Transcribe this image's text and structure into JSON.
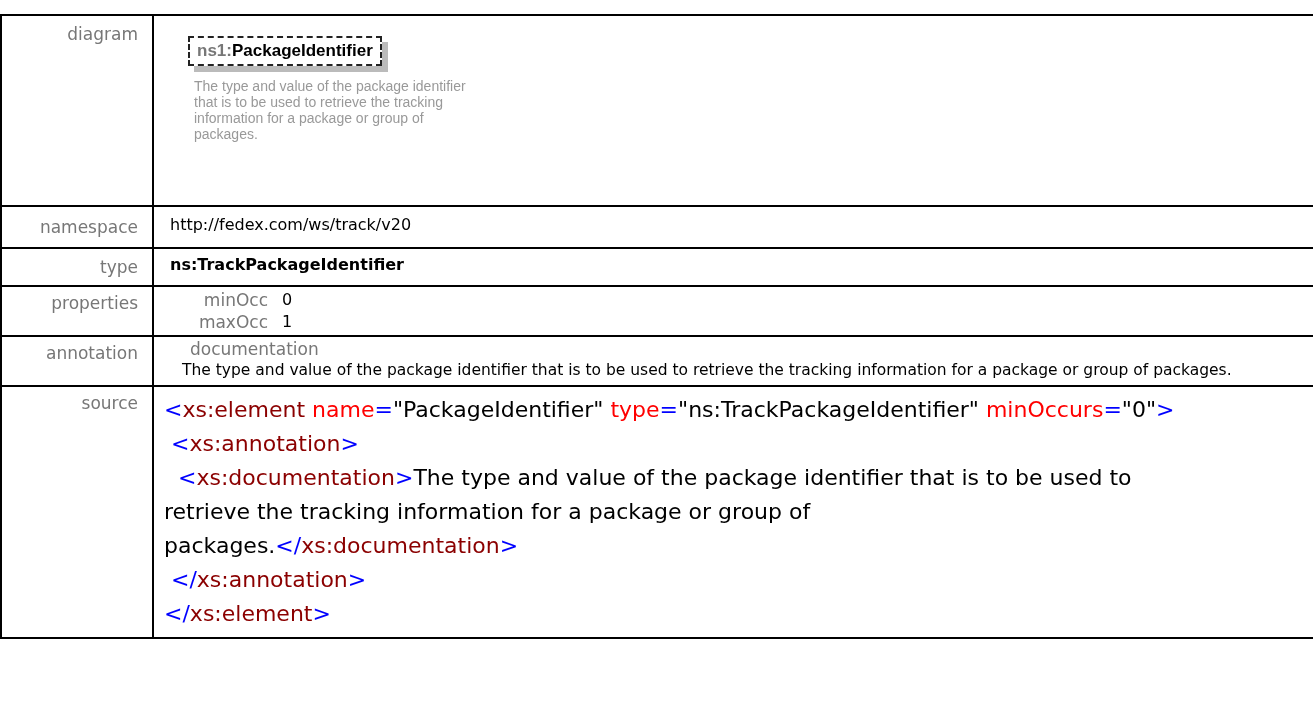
{
  "diagram": {
    "label": "diagram",
    "prefix": "ns1:",
    "name": "PackageIdentifier",
    "description": "The type and value of the package identifier that is to be used to retrieve the tracking information for a package or group of packages."
  },
  "namespace": {
    "label": "namespace",
    "value": "http://fedex.com/ws/track/v20"
  },
  "type": {
    "label": "type",
    "value": "ns:TrackPackageIdentifier"
  },
  "properties": {
    "label": "properties",
    "items": [
      {
        "name": "minOcc",
        "value": "0"
      },
      {
        "name": "maxOcc",
        "value": "1"
      }
    ]
  },
  "annotation": {
    "label": "annotation",
    "heading": "documentation",
    "text": "The type and value of the package identifier  that is to be used to retrieve the tracking information for a package or group of packages."
  },
  "source": {
    "label": "source",
    "lines": [
      [
        {
          "kind": "bracket",
          "text": "<"
        },
        {
          "kind": "tag",
          "text": "xs:element"
        },
        {
          "kind": "attr",
          "text": " name"
        },
        {
          "kind": "bracket",
          "text": "="
        },
        {
          "kind": "value",
          "text": "\"PackageIdentifier\""
        },
        {
          "kind": "attr",
          "text": " type"
        },
        {
          "kind": "bracket",
          "text": "="
        },
        {
          "kind": "value",
          "text": "\"ns:TrackPackageIdentifier\""
        },
        {
          "kind": "attr",
          "text": " minOccurs"
        },
        {
          "kind": "bracket",
          "text": "="
        },
        {
          "kind": "value",
          "text": "\"0\""
        },
        {
          "kind": "bracket",
          "text": ">"
        }
      ],
      [
        {
          "kind": "bracket",
          "text": " <"
        },
        {
          "kind": "tag",
          "text": "xs:annotation"
        },
        {
          "kind": "bracket",
          "text": ">"
        }
      ],
      [
        {
          "kind": "bracket",
          "text": "  <"
        },
        {
          "kind": "tag",
          "text": "xs:documentation"
        },
        {
          "kind": "bracket",
          "text": ">"
        },
        {
          "kind": "value",
          "text": "The type and value of the package identifier that is to be used to"
        }
      ],
      [
        {
          "kind": "value",
          "text": "retrieve the tracking information for a package or group of"
        }
      ],
      [
        {
          "kind": "value",
          "text": "packages."
        },
        {
          "kind": "bracket",
          "text": "</"
        },
        {
          "kind": "tag",
          "text": "xs:documentation"
        },
        {
          "kind": "bracket",
          "text": ">"
        }
      ],
      [
        {
          "kind": "bracket",
          "text": " </"
        },
        {
          "kind": "tag",
          "text": "xs:annotation"
        },
        {
          "kind": "bracket",
          "text": ">"
        }
      ],
      [
        {
          "kind": "bracket",
          "text": "</"
        },
        {
          "kind": "tag",
          "text": "xs:element"
        },
        {
          "kind": "bracket",
          "text": ">"
        }
      ]
    ]
  }
}
